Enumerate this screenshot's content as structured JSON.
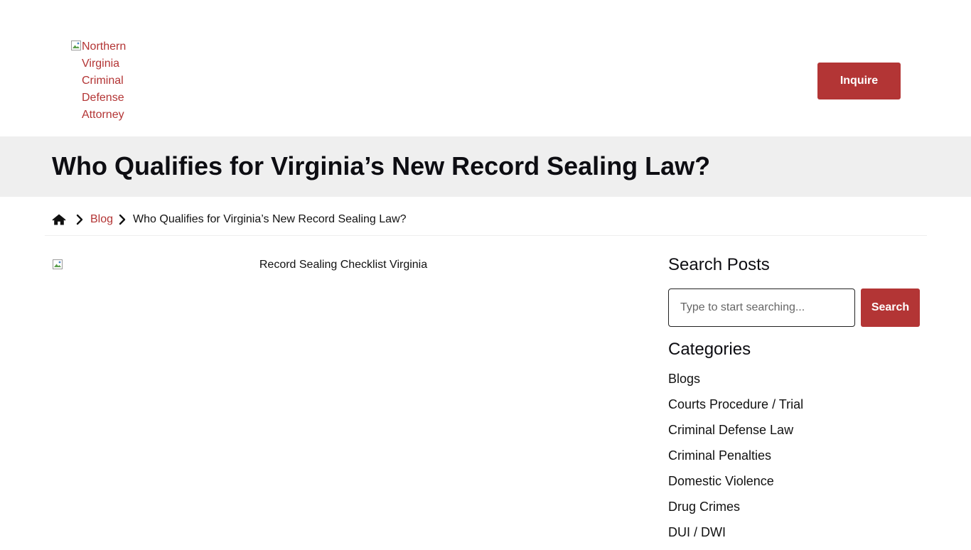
{
  "header": {
    "logo_alt": "Northern Virginia Criminal Defense Attorney",
    "inquire_label": "Inquire"
  },
  "page": {
    "title": "Who Qualifies for Virginia’s New Record Sealing Law?"
  },
  "breadcrumb": {
    "home_icon": "home-icon",
    "blog": "Blog",
    "current": "Who Qualifies for Virginia’s New Record Sealing Law?"
  },
  "featured_image": {
    "alt": "Record Sealing Checklist Virginia"
  },
  "sidebar": {
    "search_heading": "Search Posts",
    "search_placeholder": "Type to start searching...",
    "search_button": "Search",
    "categories_heading": "Categories",
    "categories": [
      "Blogs",
      "Courts Procedure / Trial",
      "Criminal Defense Law",
      "Criminal Penalties",
      "Domestic Violence",
      "Drug Crimes",
      "DUI / DWI"
    ]
  },
  "colors": {
    "accent": "#b33535",
    "title_band": "#efefef",
    "text": "#111111"
  }
}
